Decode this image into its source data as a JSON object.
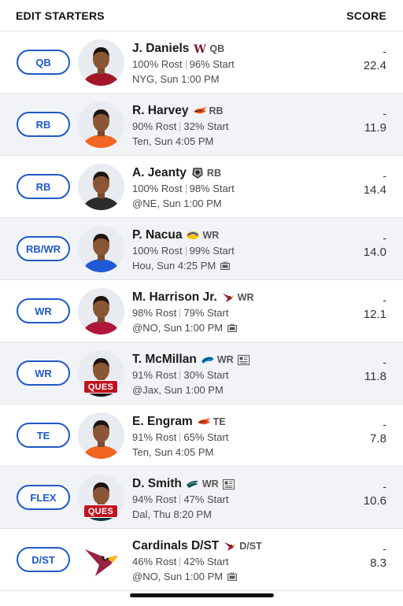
{
  "header": {
    "left": "EDIT STARTERS",
    "right": "SCORE"
  },
  "rows": [
    {
      "slot": "QB",
      "name": "J. Daniels",
      "team_icon": "commanders-logo-icon",
      "team_color": "#7a1e2b",
      "pos": "QB",
      "rost": "100% Rost",
      "start": "96% Start",
      "game": "NYG, Sun 1:00 PM",
      "tv": false,
      "news": false,
      "status": "",
      "proj": "-",
      "score": "22.4",
      "jersey": "#a3162a"
    },
    {
      "slot": "RB",
      "name": "R. Harvey",
      "team_icon": "broncos-logo-icon",
      "team_color": "#fb4f14",
      "pos": "RB",
      "rost": "90% Rost",
      "start": "32% Start",
      "game": "Ten, Sun 4:05 PM",
      "tv": false,
      "news": false,
      "status": "",
      "proj": "-",
      "score": "11.9",
      "jersey": "#f26522"
    },
    {
      "slot": "RB",
      "name": "A. Jeanty",
      "team_icon": "raiders-logo-icon",
      "team_color": "#222222",
      "pos": "RB",
      "rost": "100% Rost",
      "start": "98% Start",
      "game": "@NE, Sun 1:00 PM",
      "tv": false,
      "news": false,
      "status": "",
      "proj": "-",
      "score": "14.4",
      "jersey": "#2b2b2b"
    },
    {
      "slot": "RB/WR",
      "name": "P. Nacua",
      "team_icon": "rams-logo-icon",
      "team_color": "#1b4fc4",
      "pos": "WR",
      "rost": "100% Rost",
      "start": "99% Start",
      "game": "Hou, Sun 4:25 PM",
      "tv": true,
      "news": false,
      "status": "",
      "proj": "-",
      "score": "14.0",
      "jersey": "#1f5ad4"
    },
    {
      "slot": "WR",
      "name": "M. Harrison Jr.",
      "team_icon": "cardinals-logo-icon",
      "team_color": "#97233f",
      "pos": "WR",
      "rost": "98% Rost",
      "start": "79% Start",
      "game": "@NO, Sun 1:00 PM",
      "tv": true,
      "news": false,
      "status": "",
      "proj": "-",
      "score": "12.1",
      "jersey": "#b0163a"
    },
    {
      "slot": "WR",
      "name": "T. McMillan",
      "team_icon": "panthers-logo-icon",
      "team_color": "#0085ca",
      "pos": "WR",
      "rost": "91% Rost",
      "start": "30% Start",
      "game": "@Jax, Sun 1:00 PM",
      "tv": false,
      "news": true,
      "status": "QUES",
      "proj": "-",
      "score": "11.8",
      "jersey": "#0b0b0b"
    },
    {
      "slot": "TE",
      "name": "E. Engram",
      "team_icon": "broncos-logo-icon",
      "team_color": "#fb4f14",
      "pos": "TE",
      "rost": "91% Rost",
      "start": "65% Start",
      "game": "Ten, Sun 4:05 PM",
      "tv": false,
      "news": false,
      "status": "",
      "proj": "-",
      "score": "7.8",
      "jersey": "#f26522"
    },
    {
      "slot": "FLEX",
      "name": "D. Smith",
      "team_icon": "eagles-logo-icon",
      "team_color": "#004c54",
      "pos": "WR",
      "rost": "94% Rost",
      "start": "47% Start",
      "game": "Dal, Thu 8:20 PM",
      "tv": false,
      "news": true,
      "status": "QUES",
      "proj": "-",
      "score": "10.6",
      "jersey": "#0b3b3f"
    },
    {
      "slot": "D/ST",
      "name": "Cardinals D/ST",
      "team_icon": "cardinals-logo-icon",
      "team_color": "#97233f",
      "pos": "D/ST",
      "rost": "46% Rost",
      "start": "42% Start",
      "game": "@NO, Sun 1:00 PM",
      "tv": true,
      "news": false,
      "status": "",
      "proj": "-",
      "score": "8.3",
      "jersey": "",
      "is_defense": true
    }
  ],
  "colors": {
    "accent": "#1f59c7",
    "injury": "#c1121f",
    "alt_row": "#f1f3f6"
  }
}
